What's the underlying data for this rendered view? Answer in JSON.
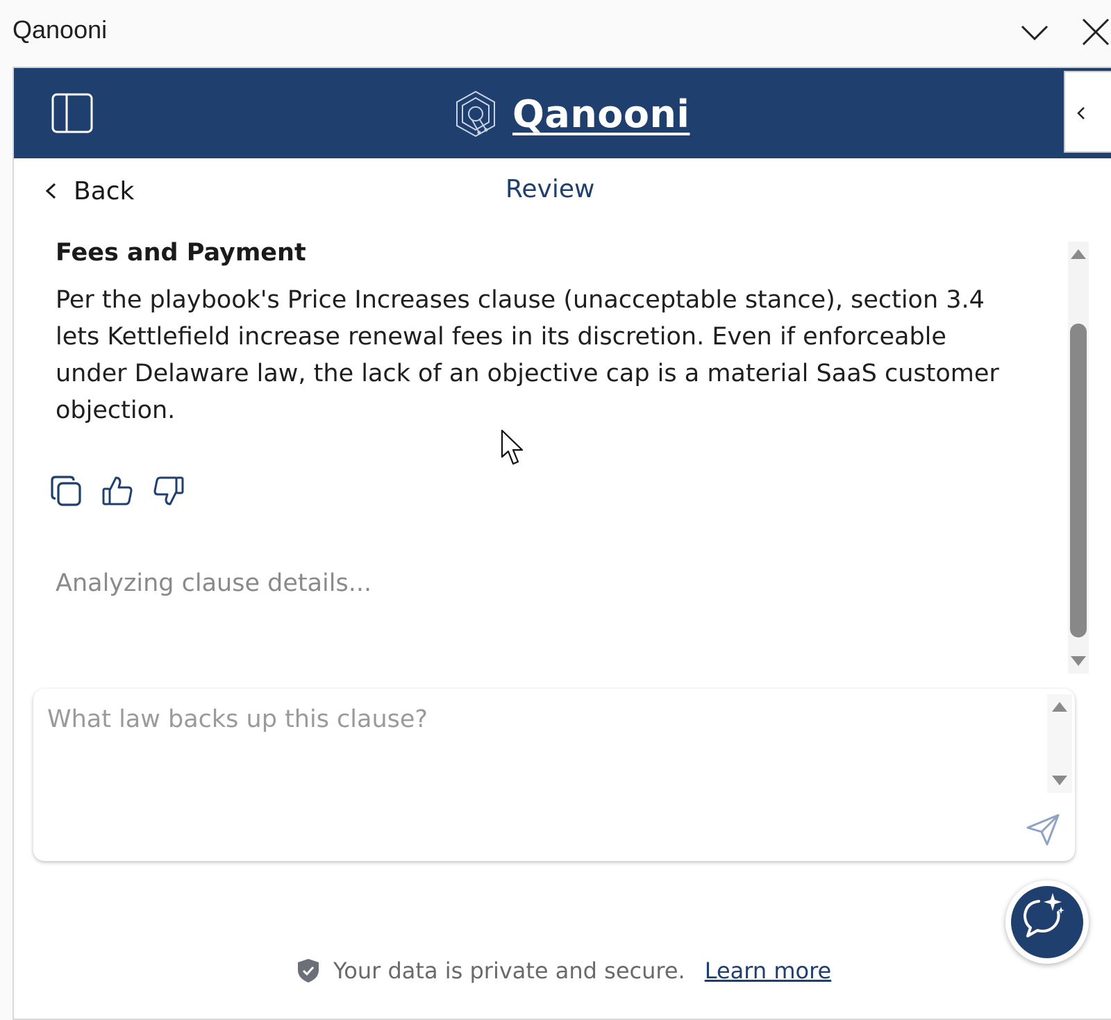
{
  "host": {
    "title": "Qanooni"
  },
  "header": {
    "brand": "Qanooni"
  },
  "nav": {
    "back_label": "Back",
    "title": "Review"
  },
  "clause": {
    "title": "Fees and Payment",
    "body": "Per the playbook's Price Increases clause (unacceptable stance), section 3.4 lets Kettlefield increase renewal fees in its discretion. Even if enforceable under Delaware law, the lack of an objective cap is a material SaaS customer objection."
  },
  "status": {
    "analyzing": "Analyzing clause details..."
  },
  "input": {
    "placeholder": "What law backs up this clause?",
    "value": ""
  },
  "footer": {
    "text": "Your data is private and secure.",
    "link": "Learn more"
  },
  "icons": {
    "host_minimize": "chevron-down-icon",
    "host_close": "close-icon",
    "sidebar_toggle": "sidebar-icon",
    "logo": "qanooni-logo-icon",
    "collapse": "chevron-left-icon",
    "back": "chevron-left-icon",
    "copy": "copy-icon",
    "thumbs_up": "thumbs-up-icon",
    "thumbs_down": "thumbs-down-icon",
    "send": "send-icon",
    "chat": "chat-sparkle-icon",
    "shield": "shield-check-icon"
  },
  "colors": {
    "brand_navy": "#1f3f6e",
    "muted_text": "#8a8a8a",
    "scroll_thumb": "#888888"
  }
}
